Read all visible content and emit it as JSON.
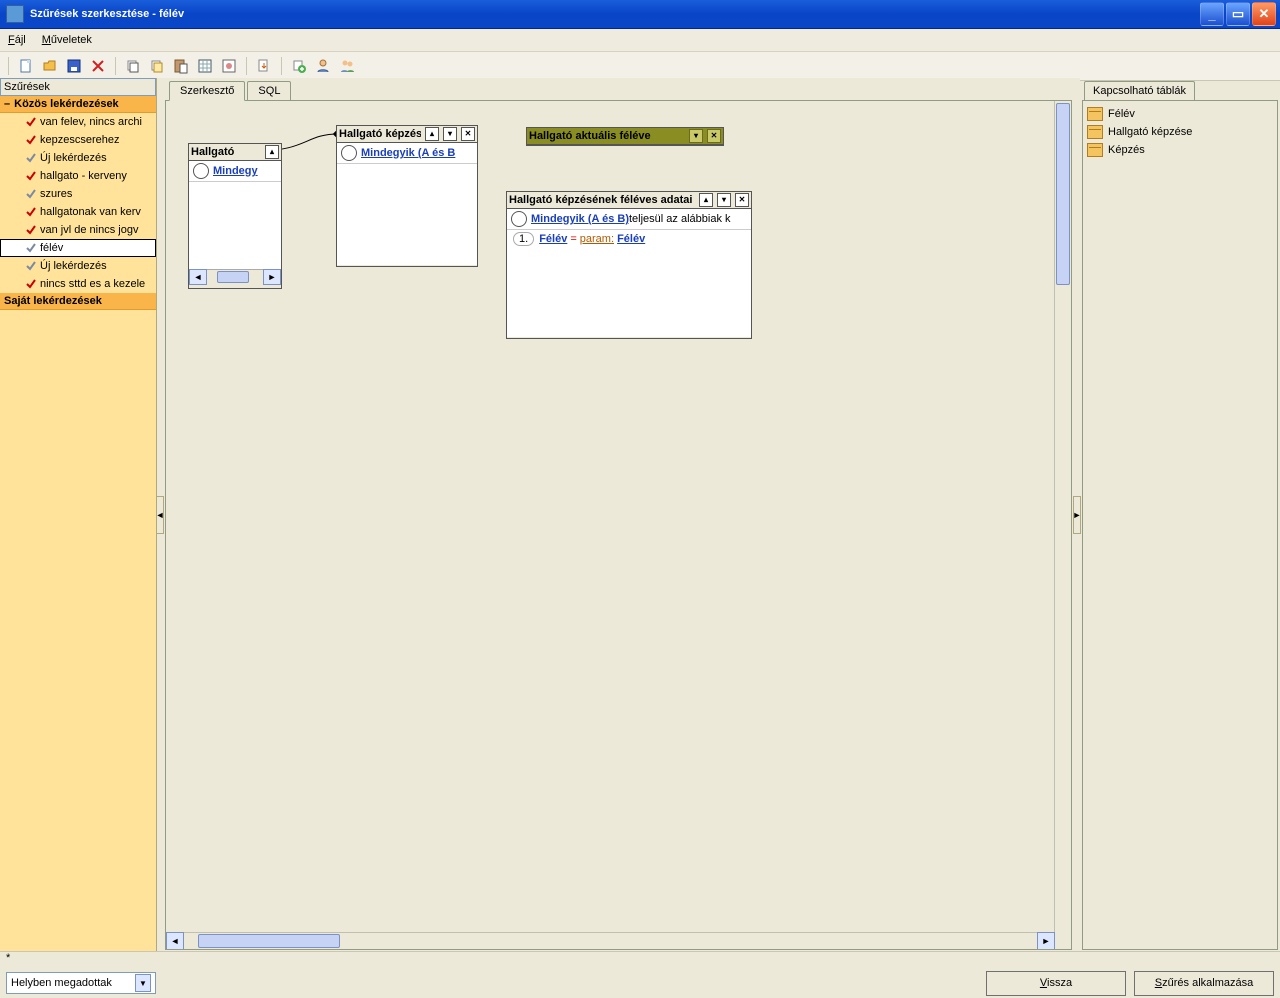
{
  "window": {
    "title": "Szűrések szerkesztése - félév"
  },
  "menu": {
    "file": "Fájl",
    "ops": "Műveletek"
  },
  "left": {
    "header": "Szűrések",
    "group1": "Közös lekérdezések",
    "group2": "Saját lekérdezések",
    "items": [
      {
        "label": "van felev, nincs archi",
        "kind": "red"
      },
      {
        "label": "kepzescserehez",
        "kind": "red"
      },
      {
        "label": "Új lekérdezés",
        "kind": "gray"
      },
      {
        "label": "hallgato - kerveny",
        "kind": "red"
      },
      {
        "label": "szures",
        "kind": "gray"
      },
      {
        "label": "hallgatonak van kerv",
        "kind": "red"
      },
      {
        "label": "van jvl de nincs jogv",
        "kind": "red"
      },
      {
        "label": "félév",
        "kind": "gray",
        "selected": true
      },
      {
        "label": "Új lekérdezés",
        "kind": "gray"
      },
      {
        "label": "nincs sttd es a kezele",
        "kind": "red"
      }
    ]
  },
  "tabs": {
    "t1": "Szerkesztő",
    "t2": "SQL"
  },
  "ent": {
    "hallgato": {
      "title": "Hallgató",
      "cond": "Mindegy"
    },
    "kepzese": {
      "title": "Hallgató képzése",
      "cond": "Mindegyik (A és B"
    },
    "aktualis": {
      "title": "Hallgató aktuális féléve"
    },
    "feleves": {
      "title": "Hallgató képzésének féléves adatai",
      "cond": "Mindegyik (A és B)",
      "condTail": " teljesül az alábbiak k",
      "rowNum": "1.",
      "field": "Félév",
      "op": "=",
      "paramLbl": "param:",
      "paramVal": "Félév"
    }
  },
  "right": {
    "tab": "Kapcsolható táblák",
    "items": [
      "Félév",
      "Hallgató képzése",
      "Képzés"
    ]
  },
  "footer": {
    "star": "*",
    "select": "Helyben megadottak",
    "back": "Vissza",
    "apply": "Szűrés alkalmazása"
  }
}
